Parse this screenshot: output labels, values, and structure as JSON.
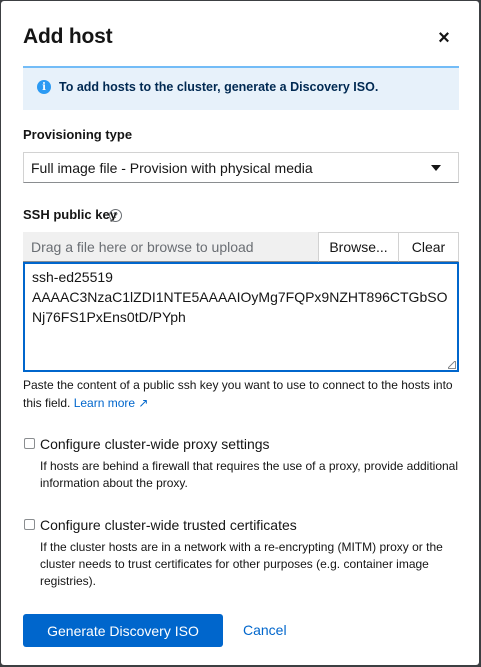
{
  "modal": {
    "title": "Add host",
    "close_glyph": "×",
    "alert": {
      "icon": "info-icon",
      "icon_glyph": "i",
      "text": "To add hosts to the cluster, generate a Discovery ISO."
    },
    "provisioning": {
      "label": "Provisioning type",
      "selected": "Full image file - Provision with physical media"
    },
    "ssh": {
      "label": "SSH public key",
      "help_glyph": "?",
      "upload_placeholder": "Drag a file here or browse to upload",
      "browse_label": "Browse...",
      "clear_label": "Clear",
      "key_lines": [
        "ssh-ed25519",
        "AAAAC3NzaC1lZDI1NTE5AAAAIOyMg7FQPx9NZHT896CTGbSO",
        "Nj76FS1PxEns0tD/PYph"
      ],
      "helper_text": "Paste the content of a public ssh key you want to use to connect to the hosts into this field.",
      "learn_more": "Learn more",
      "external_glyph": "↗"
    },
    "proxy": {
      "label": "Configure cluster-wide proxy settings",
      "description": "If hosts are behind a firewall that requires the use of a proxy, provide additional information about the proxy.",
      "checked": false
    },
    "certs": {
      "label": "Configure cluster-wide trusted certificates",
      "description": "If the cluster hosts are in a network with a re-encrypting (MITM) proxy or the cluster needs to trust certificates for other purposes (e.g. container image registries).",
      "checked": false
    },
    "footer": {
      "primary_label": "Generate Discovery ISO",
      "cancel_label": "Cancel"
    }
  },
  "colors": {
    "primary": "#0066cc",
    "alert_bg": "#e7f1fa",
    "alert_icon": "#2b9af3",
    "backdrop": "#3c3f42"
  }
}
